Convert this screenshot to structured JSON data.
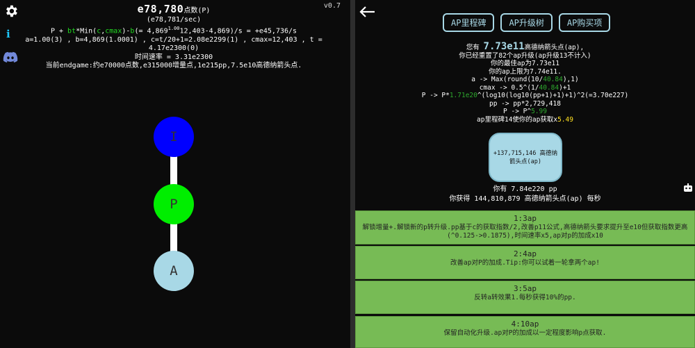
{
  "left": {
    "version": "v0.7",
    "points_big": "e78,780",
    "points_unit": "点数(P)",
    "points_rate": "(e78,781/sec)",
    "formula_pre": "P + ",
    "formula_bt": "bt",
    "formula_mid": "*Min(",
    "formula_c": "c",
    "formula_comma": ",",
    "formula_cmax": "cmax",
    "formula_after": ")-",
    "formula_b": "b",
    "formula_eq": "(= 4,869",
    "formula_sup": "1.00",
    "formula_tail": "12,403-4,869)/s = +e45,736/s",
    "vars_line": "a=1.00(3) , b=4,869(1.0001) , c=t/20+1=2.08e2299(1) , cmax=12,403 , t = 4.17e2300(0)",
    "time_rate": "时间速率 = 3.31e2300",
    "endgame": "当前endgame:约e70000点数,e315000增量点,1e215pp,7.5e10高德纳箭头点.",
    "nodes": [
      {
        "label": "I",
        "color": "#0000ff"
      },
      {
        "label": "P",
        "color": "#00ee00"
      },
      {
        "label": "A",
        "color": "#a8d8e6"
      }
    ]
  },
  "right": {
    "tabs": [
      "AP里程碑",
      "AP升级树",
      "AP购买项"
    ],
    "you_have": "您有 ",
    "ap_big": "7.73e11",
    "ap_unit": "高德纳箭头点(ap),",
    "reset_line": "你已经重置了82个ap升级(ap升级13不计入)",
    "best_line": "你的最佳ap为7.73e11",
    "cap_line": "你的ap上限为7.74e11.",
    "formula_a_pre": "a -> Max(round(10/",
    "formula_a_g": "40.84",
    "formula_a_post": "),1)",
    "formula_cmax_pre": "cmax -> 0.5^(1/",
    "formula_cmax_g": "40.84",
    "formula_cmax_post": ")+1",
    "formula_p_pre": "P -> P*",
    "formula_p_g": "1.71e20",
    "formula_p_post": "^(log10(log10(pp+1)+1)+1)^2(=3.70e227)",
    "formula_pp": "pp -> pp*2,729,418",
    "formula_pp2_pre": "P -> P^",
    "formula_pp2_g": "5.99",
    "milestone_mult_pre": "ap里程碑14使你的ap获取x",
    "milestone_mult_y": "5.49",
    "prestige_button": "+137,715,146 高德纳箭头点(ap)",
    "pp_have": "你有 7.84e220 pp",
    "ap_per_sec": "你获得 144,810,879 高德纳箭头点(ap) 每秒",
    "milestones": [
      {
        "title": "1:3ap",
        "desc": "解锁增量+.解锁新的p转升级.pp基于c的获取指数/2,改善p11公式,高德纳箭头要求提升至e10但获取指数更高(^0.125->0.1875),时间速率x5,ap对p的加成x10"
      },
      {
        "title": "2:4ap",
        "desc": "改善ap对P的加成.Tip:你可以试着一轮拿两个ap!"
      },
      {
        "title": "3:5ap",
        "desc": "反转a转效果1.每秒获得10%的pp."
      },
      {
        "title": "4:10ap",
        "desc": "保留自动化升级.ap对P的加成以一定程度影响p点获取."
      }
    ]
  }
}
